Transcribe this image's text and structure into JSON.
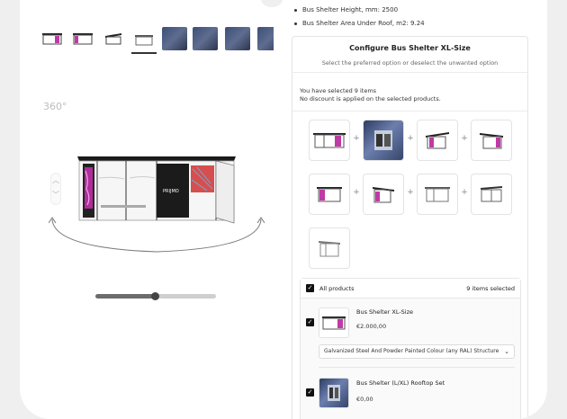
{
  "gallery": {
    "rotation_label": "360°",
    "thumbnails": [
      {
        "kind": "shelter-icon"
      },
      {
        "kind": "shelter-icon"
      },
      {
        "kind": "shelter-icon"
      },
      {
        "kind": "shelter-icon",
        "selected": true
      },
      {
        "kind": "photo"
      },
      {
        "kind": "photo"
      },
      {
        "kind": "photo"
      },
      {
        "kind": "photo"
      }
    ],
    "zoom_level": 0.5
  },
  "specs": [
    "Bus Shelter Height, mm: 2500",
    "Bus Shelter Area Under Roof, m2: 9.24"
  ],
  "configurator": {
    "title": "Configure Bus Shelter XL-Size",
    "subtitle": "Select the preferred option or deselect the unwanted option",
    "selected_line": "You have selected 9 items",
    "discount_line": "No discount is applied on the selected products.",
    "options_count": 9
  },
  "product_list": {
    "all_label": "All products",
    "count_label": "9 items selected",
    "items": [
      {
        "name": "Bus Shelter XL-Size",
        "price": "€2.000,00",
        "variant": "Galvanized Steel And Powder Painted Colour (any RAL) Structure"
      },
      {
        "name": "Bus Shelter (L/XL) Rooftop Set",
        "price": "€0,00"
      }
    ]
  },
  "icons": {
    "check": "check-icon",
    "chevron": "chevron-down-icon",
    "plus": "plus-icon"
  }
}
